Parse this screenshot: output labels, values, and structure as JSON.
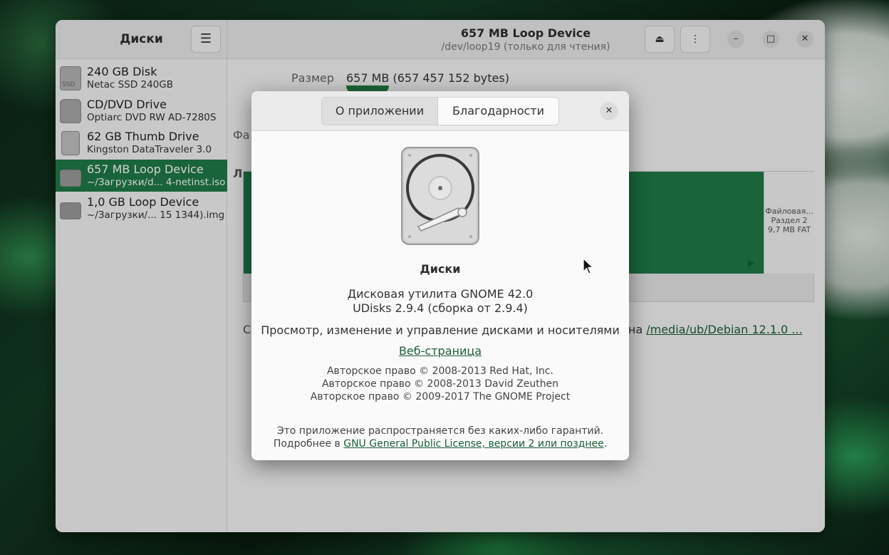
{
  "sidebar": {
    "title": "Диски",
    "drives": [
      {
        "name": "240 GB Disk",
        "sub": "Netac SSD 240GB"
      },
      {
        "name": "CD/DVD Drive",
        "sub": "Optiarc DVD RW AD-7280S"
      },
      {
        "name": "62 GB Thumb Drive",
        "sub": "Kingston DataTraveler 3.0"
      },
      {
        "name": "657 MB Loop Device",
        "sub": "~/Загрузки/d... 4-netinst.iso"
      },
      {
        "name": "1,0 GB Loop Device",
        "sub": "~/Загрузки/... 15 1344).img"
      }
    ]
  },
  "header": {
    "title": "657 MB Loop Device",
    "subtitle": "/dev/loop19 (только для чтения)"
  },
  "content": {
    "size_label": "Размер",
    "size_value": "657 MB (657 457 152 bytes)",
    "partition2": {
      "line1": "Файловая...",
      "line2": "Раздел 2",
      "line3": "9,7 MB FAT"
    },
    "mount_prefix": "С",
    "mount_text": "о на",
    "mount_path": "/media/ub/Debian 12.1.0 ..."
  },
  "about": {
    "tabs": [
      "О приложении",
      "Благодарности"
    ],
    "app_name": "Диски",
    "version_line1": "Дисковая утилита GNOME 42.0",
    "version_line2": "UDisks 2.9.4 (сборка от 2.9.4)",
    "description": "Просмотр, изменение и управление дисками и носителями",
    "website": "Веб-страница",
    "copyright": [
      "Авторское право © 2008-2013 Red Hat, Inc.",
      "Авторское право © 2008-2013 David Zeuthen",
      "Авторское право © 2009-2017 The GNOME Project"
    ],
    "warranty": "Это приложение распространяется без каких-либо гарантий.",
    "license_prefix": "Подробнее в",
    "license_link": "GNU General Public License, версии 2 или позднее",
    "license_suffix": "."
  }
}
